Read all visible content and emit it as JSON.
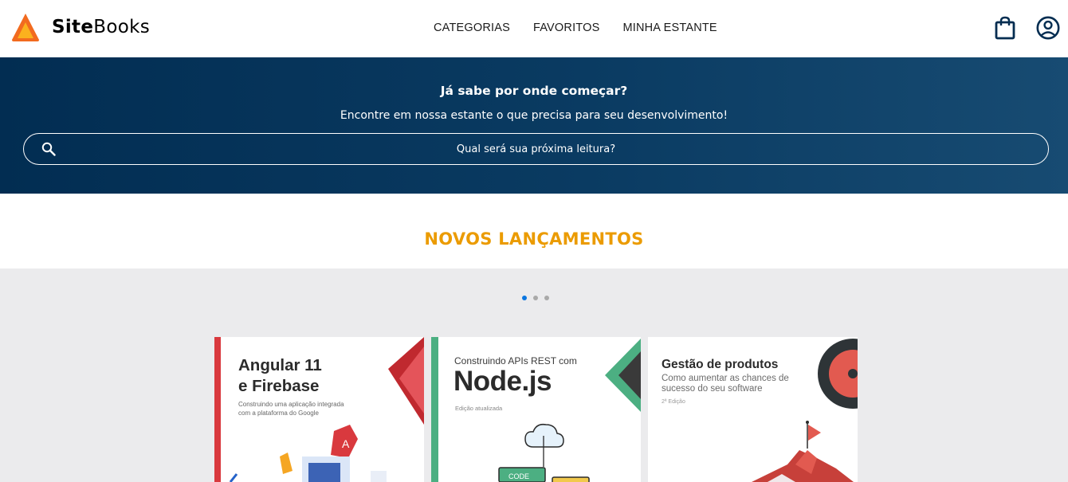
{
  "header": {
    "logo_bold": "Site",
    "logo_rest": "Books",
    "nav": [
      "CATEGORIAS",
      "FAVORITOS",
      "MINHA ESTANTE"
    ]
  },
  "banner": {
    "title": "Já sabe por onde começar?",
    "subtitle": "Encontre em nossa estante o que precisa para seu desenvolvimento!",
    "search_placeholder": "Qual será sua próxima leitura?"
  },
  "section": {
    "title": "NOVOS LANÇAMENTOS"
  },
  "carousel": {
    "dots": 3,
    "active_dot": 0
  },
  "books": [
    {
      "title_line1": "Angular 11",
      "title_line2": "e Firebase",
      "subtitle_line1": "Construindo uma aplicação integrada",
      "subtitle_line2": "com a plataforma do Google",
      "accent": "#d9393e"
    },
    {
      "kicker": "Construindo APIs REST com",
      "title": "Node.js",
      "edition": "Edição atualizada",
      "badge": "CODE",
      "accent": "#4caf82"
    },
    {
      "title": "Gestão de produtos",
      "subtitle_line1": "Como aumentar as chances de",
      "subtitle_line2": "sucesso do seu software",
      "edition": "2ª Edição",
      "accent": "#e25a50"
    }
  ],
  "colors": {
    "banner_start": "#022d52",
    "banner_end": "#174b72",
    "section_title": "#eb9b00",
    "carousel_bg": "#ebebed",
    "active_dot": "#0b76e0"
  },
  "icons": [
    "logo-icon",
    "shopping-bag-icon",
    "user-account-icon",
    "search-icon"
  ]
}
